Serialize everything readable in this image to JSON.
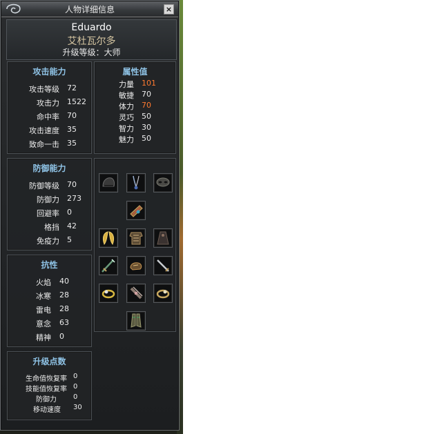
{
  "window": {
    "title": "人物详细信息",
    "close_label": "×"
  },
  "character": {
    "name": "Eduardo",
    "chinese_name": "艾杜瓦尔多",
    "level_text": "升级等级：大师"
  },
  "attack": {
    "title": "攻击能力",
    "rows": [
      {
        "label": "攻击等级",
        "value": "72"
      },
      {
        "label": "攻击力",
        "value": "1522"
      },
      {
        "label": "命中率",
        "value": "70"
      },
      {
        "label": "攻击速度",
        "value": "35"
      },
      {
        "label": "致命一击",
        "value": "35"
      }
    ]
  },
  "attributes": {
    "title": "属性值",
    "rows": [
      {
        "label": "力量",
        "value": "101",
        "highlight": true
      },
      {
        "label": "敏捷",
        "value": "70",
        "highlight": false
      },
      {
        "label": "体力",
        "value": "70",
        "highlight": true
      },
      {
        "label": "灵巧",
        "value": "50",
        "highlight": false
      },
      {
        "label": "智力",
        "value": "30",
        "highlight": false
      },
      {
        "label": "魅力",
        "value": "50",
        "highlight": false
      }
    ],
    "highlight_color": "#ff7a30"
  },
  "defense": {
    "title": "防御能力",
    "rows": [
      {
        "label": "防御等级",
        "value": "70"
      },
      {
        "label": "防御力",
        "value": "273"
      },
      {
        "label": "回避率",
        "value": "0"
      },
      {
        "label": "格挡",
        "value": "42"
      },
      {
        "label": "免疫力",
        "value": "5"
      }
    ]
  },
  "resistance": {
    "title": "抗性",
    "rows": [
      {
        "label": "火焰",
        "value": "40"
      },
      {
        "label": "冰寒",
        "value": "28"
      },
      {
        "label": "雷电",
        "value": "28"
      },
      {
        "label": "意念",
        "value": "63"
      },
      {
        "label": "精神",
        "value": "0"
      }
    ]
  },
  "upgrade_points": {
    "title": "升级点数",
    "rows": [
      {
        "label": "生命值恢复率",
        "value": "0"
      },
      {
        "label": "技能值恢复率",
        "value": "0"
      },
      {
        "label": "防御力",
        "value": "0"
      },
      {
        "label": "移动速度",
        "value": "30"
      }
    ]
  },
  "equipment": [
    {
      "icon": "helmet-icon"
    },
    {
      "icon": "necklace-icon"
    },
    {
      "icon": "mask-icon"
    },
    {
      "icon": "bracer-icon"
    },
    {
      "icon": "wings-icon"
    },
    {
      "icon": "armor-icon"
    },
    {
      "icon": "cloak-icon"
    },
    {
      "icon": "weapon-left-icon"
    },
    {
      "icon": "gloves-icon"
    },
    {
      "icon": "weapon-right-icon"
    },
    {
      "icon": "ring-left-icon"
    },
    {
      "icon": "belt-icon"
    },
    {
      "icon": "ring-right-icon"
    },
    {
      "icon": "boots-icon"
    }
  ],
  "colors": {
    "panel_title": "#8fc3e6",
    "text": "#ececec",
    "name_cn": "#d6c6a2"
  }
}
